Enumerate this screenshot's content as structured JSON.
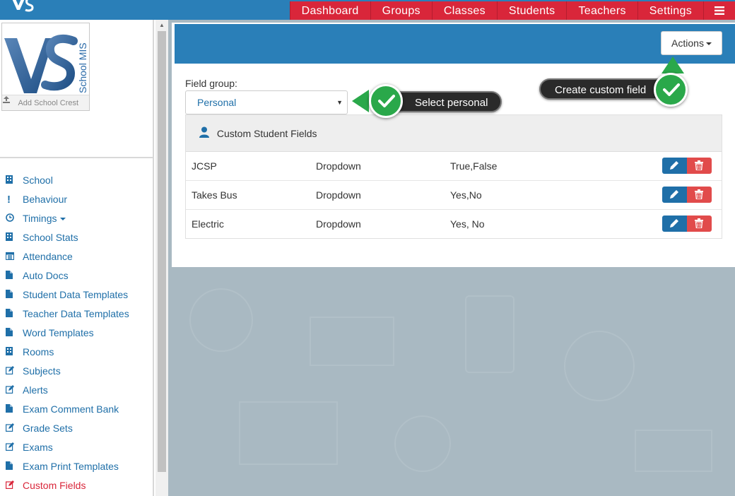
{
  "topnav": {
    "items": [
      "Dashboard",
      "Groups",
      "Classes",
      "Students",
      "Teachers",
      "Settings"
    ],
    "menu_icon": "hamburger-icon"
  },
  "crest": {
    "logo_text": "School MIS",
    "upload_label": "Add School Crest"
  },
  "sidebar": {
    "items": [
      {
        "label": "School",
        "icon": "building-icon"
      },
      {
        "label": "Behaviour",
        "icon": "exclamation-icon"
      },
      {
        "label": "Timings",
        "icon": "clock-icon"
      },
      {
        "label": "School Stats",
        "icon": "building-icon"
      },
      {
        "label": "Attendance",
        "icon": "calendar-icon"
      },
      {
        "label": "Auto Docs",
        "icon": "file-icon"
      },
      {
        "label": "Student Data Templates",
        "icon": "file-icon"
      },
      {
        "label": "Teacher Data Templates",
        "icon": "file-icon"
      },
      {
        "label": "Word Templates",
        "icon": "file-icon"
      },
      {
        "label": "Rooms",
        "icon": "building-icon"
      },
      {
        "label": "Subjects",
        "icon": "edit-icon"
      },
      {
        "label": "Alerts",
        "icon": "edit-icon"
      },
      {
        "label": "Exam Comment Bank",
        "icon": "file-icon"
      },
      {
        "label": "Grade Sets",
        "icon": "edit-icon"
      },
      {
        "label": "Exams",
        "icon": "edit-icon"
      },
      {
        "label": "Exam Print Templates",
        "icon": "file-icon"
      },
      {
        "label": "Custom Fields",
        "icon": "edit-icon"
      }
    ],
    "active": "Custom Fields"
  },
  "panel": {
    "actions_label": "Actions",
    "field_group_label": "Field group:",
    "field_group_value": "Personal",
    "card_title": "Custom Student Fields",
    "rows": [
      {
        "name": "JCSP",
        "type": "Dropdown",
        "options": "True,False"
      },
      {
        "name": "Takes Bus",
        "type": "Dropdown",
        "options": "Yes,No"
      },
      {
        "name": "Electric",
        "type": "Dropdown",
        "options": "Yes, No"
      }
    ]
  },
  "tooltips": {
    "select_personal": "Select personal",
    "create_custom_field": "Create custom field"
  },
  "colors": {
    "brand_blue": "#2a7fb8",
    "nav_red": "#d9263a",
    "link_blue": "#1f6fa8",
    "delete_red": "#e14b4b",
    "tip_green": "#2aa84a"
  }
}
